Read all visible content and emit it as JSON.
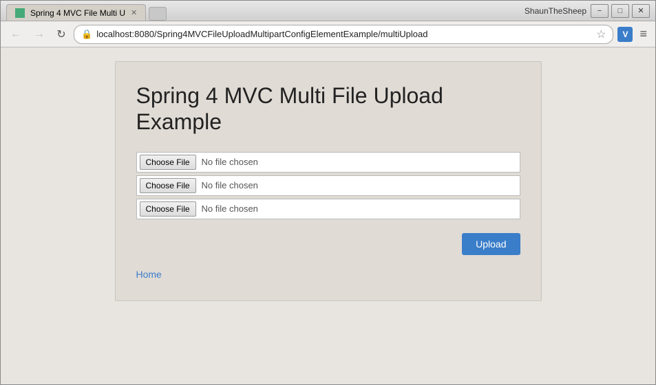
{
  "window": {
    "user_label": "ShaunTheSheep",
    "tab_title": "Spring 4 MVC File Multi U",
    "favicon_alt": "app-icon"
  },
  "controls": {
    "minimize": "−",
    "maximize": "□",
    "close": "✕"
  },
  "nav": {
    "back_icon": "←",
    "forward_icon": "→",
    "refresh_icon": "↻",
    "address": "localhost:8080/Spring4MVCFileUploadMultipartConfigElementExample/multiUpload",
    "star_icon": "☆",
    "ext_label": "V",
    "menu_icon": "≡"
  },
  "page": {
    "title_line1": "Spring 4 MVC Multi File Upload",
    "title_line2": "Example",
    "file_inputs": [
      {
        "button_label": "Choose File",
        "status": "No file chosen"
      },
      {
        "button_label": "Choose File",
        "status": "No file chosen"
      },
      {
        "button_label": "Choose File",
        "status": "No file chosen"
      }
    ],
    "upload_button": "Upload",
    "home_link": "Home"
  }
}
